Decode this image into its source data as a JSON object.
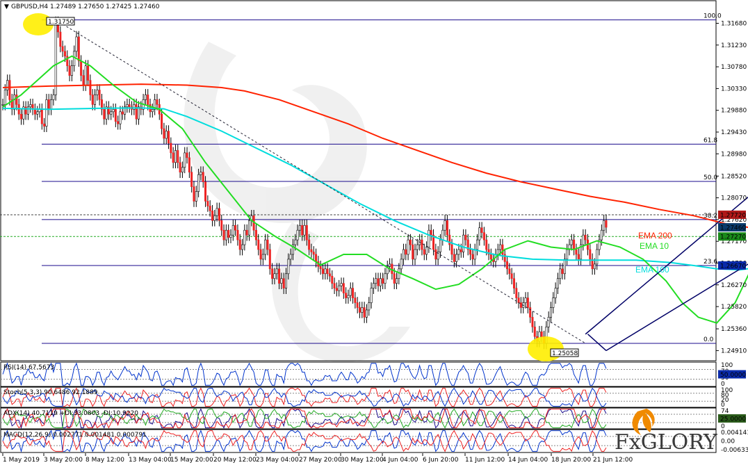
{
  "header": {
    "symbol": "GBPUSD,H4",
    "ohlc": "1.27489 1.27650 1.27425 1.27460"
  },
  "watermark": {
    "brand": "FxGLORY",
    "logo_name": "fxglory-logo"
  },
  "colors": {
    "ema200": "#ff2200",
    "ema10": "#22dd22",
    "ema100": "#00dddd",
    "fib": "#1a0a8c",
    "candle": "#ee2222",
    "channel": "#000066",
    "highlight": "#ffee00"
  },
  "chart_data": {
    "type": "candlestick",
    "title": "GBPUSD,H4",
    "ylim": [
      1.2487,
      1.3205
    ],
    "y_ticks": [
      "1.31680",
      "1.31230",
      "1.30780",
      "1.30330",
      "1.29880",
      "1.29430",
      "1.28980",
      "1.28520",
      "1.28070",
      "1.27620",
      "1.27170",
      "1.26720",
      "1.26270",
      "1.25820",
      "1.25360",
      "1.24910"
    ],
    "x_ticks": [
      "1 May 2019",
      "3 May 20:00",
      "8 May 12:00",
      "13 May 04:00",
      "15 May 20:00",
      "20 May 12:00",
      "23 May 04:00",
      "27 May 20:00",
      "30 May 12:00",
      "4 Jun 04:00",
      "6 Jun 20:00",
      "11 Jun 12:00",
      "14 Jun 04:00",
      "18 Jun 20:00",
      "21 Jun 12:00"
    ],
    "high": {
      "label": "1.31750",
      "value": 1.3175
    },
    "low": {
      "label": "1.25058",
      "value": 1.25058
    },
    "price_labels": [
      {
        "label": "1.27720",
        "value": 1.2772,
        "color": "#b01818"
      },
      {
        "label": "1.27460",
        "value": 1.2746,
        "color": "#0a3a6a"
      },
      {
        "label": "1.27270",
        "value": 1.2727,
        "color": "#1a8a1a"
      },
      {
        "label": "1.26670",
        "value": 1.2667,
        "color": "#0a2aaa"
      }
    ],
    "fibonacci": [
      {
        "label": "100.0",
        "value": 1.3175
      },
      {
        "label": "61.8",
        "value": 1.2918
      },
      {
        "label": "50.0",
        "value": 1.2841
      },
      {
        "label": "38.2",
        "value": 1.2762
      },
      {
        "label": "23.6",
        "value": 1.2667
      },
      {
        "label": "0.0",
        "value": 1.2506
      }
    ],
    "legend": [
      {
        "name": "EMA 200",
        "color": "#ff2200"
      },
      {
        "name": "EMA 10",
        "color": "#22dd22"
      },
      {
        "name": "EMA 100",
        "color": "#00dddd"
      }
    ],
    "ema200": [
      [
        0,
        1.3035
      ],
      [
        20,
        1.3038
      ],
      [
        40,
        1.304
      ],
      [
        60,
        1.3042
      ],
      [
        80,
        1.304
      ],
      [
        95,
        1.3035
      ],
      [
        105,
        1.3028
      ],
      [
        120,
        1.301
      ],
      [
        135,
        1.2985
      ],
      [
        150,
        1.296
      ],
      [
        165,
        1.293
      ],
      [
        180,
        1.2905
      ],
      [
        195,
        1.288
      ],
      [
        210,
        1.2858
      ],
      [
        225,
        1.284
      ],
      [
        240,
        1.2825
      ],
      [
        255,
        1.281
      ],
      [
        270,
        1.2798
      ],
      [
        285,
        1.2783
      ],
      [
        300,
        1.277
      ],
      [
        315,
        1.2752
      ],
      [
        325,
        1.2745
      ],
      [
        330,
        1.2743
      ],
      [
        334,
        1.2745
      ]
    ],
    "ema100": [
      [
        0,
        1.2992
      ],
      [
        20,
        1.299
      ],
      [
        40,
        1.2992
      ],
      [
        60,
        1.2993
      ],
      [
        70,
        1.2991
      ],
      [
        80,
        1.2975
      ],
      [
        95,
        1.2945
      ],
      [
        110,
        1.291
      ],
      [
        125,
        1.2875
      ],
      [
        140,
        1.2835
      ],
      [
        155,
        1.2795
      ],
      [
        170,
        1.276
      ],
      [
        185,
        1.273
      ],
      [
        200,
        1.2705
      ],
      [
        215,
        1.2688
      ],
      [
        230,
        1.268
      ],
      [
        245,
        1.2678
      ],
      [
        260,
        1.2678
      ],
      [
        275,
        1.2678
      ],
      [
        290,
        1.2673
      ],
      [
        300,
        1.2667
      ],
      [
        310,
        1.266
      ],
      [
        320,
        1.2658
      ],
      [
        334,
        1.2667
      ]
    ],
    "ema10": [
      [
        0,
        1.2995
      ],
      [
        8,
        1.302
      ],
      [
        15,
        1.305
      ],
      [
        22,
        1.308
      ],
      [
        30,
        1.31
      ],
      [
        38,
        1.308
      ],
      [
        48,
        1.304
      ],
      [
        58,
        1.3005
      ],
      [
        68,
        1.299
      ],
      [
        78,
        1.295
      ],
      [
        88,
        1.288
      ],
      [
        98,
        1.282
      ],
      [
        108,
        1.276
      ],
      [
        118,
        1.2728
      ],
      [
        128,
        1.27
      ],
      [
        138,
        1.2668
      ],
      [
        148,
        1.269
      ],
      [
        158,
        1.269
      ],
      [
        168,
        1.266
      ],
      [
        178,
        1.264
      ],
      [
        188,
        1.2618
      ],
      [
        198,
        1.2628
      ],
      [
        208,
        1.266
      ],
      [
        218,
        1.27
      ],
      [
        228,
        1.2718
      ],
      [
        238,
        1.2705
      ],
      [
        248,
        1.27
      ],
      [
        258,
        1.2718
      ],
      [
        268,
        1.2705
      ],
      [
        278,
        1.268
      ],
      [
        288,
        1.2635
      ],
      [
        295,
        1.259
      ],
      [
        302,
        1.256
      ],
      [
        310,
        1.2548
      ],
      [
        318,
        1.259
      ],
      [
        325,
        1.266
      ],
      [
        330,
        1.2695
      ],
      [
        334,
        1.2712
      ]
    ],
    "closes": [
      1.3,
      1.303,
      1.305,
      1.301,
      1.299,
      1.302,
      1.3,
      1.298,
      1.297,
      1.2995,
      1.298,
      1.2995,
      1.3,
      1.299,
      1.298,
      1.2985,
      1.299,
      1.296,
      1.2955,
      1.301,
      1.299,
      1.301,
      1.302,
      1.317,
      1.315,
      1.312,
      1.311,
      1.31,
      1.308,
      1.306,
      1.308,
      1.311,
      1.314,
      1.309,
      1.306,
      1.304,
      1.308,
      1.305,
      1.302,
      1.3,
      1.302,
      1.303,
      1.301,
      1.299,
      1.297,
      1.2995,
      1.298,
      1.2985,
      1.299,
      1.2965,
      1.296,
      1.2985,
      1.298,
      1.2995,
      1.3,
      1.2995,
      1.299,
      1.3,
      1.297,
      1.2995,
      1.299,
      1.301,
      1.302,
      1.3,
      1.2985,
      1.299,
      1.301,
      1.3,
      1.298,
      1.295,
      1.293,
      1.2945,
      1.292,
      1.29,
      1.288,
      1.2905,
      1.288,
      1.286,
      1.287,
      1.29,
      1.289,
      1.286,
      1.283,
      1.28,
      1.282,
      1.2855,
      1.286,
      1.284,
      1.28,
      1.279,
      1.278,
      1.276,
      1.277,
      1.2785,
      1.276,
      1.274,
      1.272,
      1.274,
      1.2725,
      1.273,
      1.275,
      1.274,
      1.272,
      1.27,
      1.271,
      1.274,
      1.273,
      1.276,
      1.277,
      1.274,
      1.272,
      1.27,
      1.268,
      1.269,
      1.272,
      1.27,
      1.266,
      1.264,
      1.265,
      1.266,
      1.263,
      1.264,
      1.262,
      1.265,
      1.268,
      1.269,
      1.271,
      1.272,
      1.274,
      1.275,
      1.273,
      1.275,
      1.272,
      1.27,
      1.2695,
      1.269,
      1.2675,
      1.2665,
      1.266,
      1.265,
      1.266,
      1.265,
      1.2645,
      1.263,
      1.262,
      1.2615,
      1.2625,
      1.263,
      1.261,
      1.26,
      1.2605,
      1.262,
      1.26,
      1.259,
      1.258,
      1.257,
      1.258,
      1.256,
      1.2575,
      1.259,
      1.262,
      1.263,
      1.264,
      1.2625,
      1.264,
      1.263,
      1.265,
      1.2665,
      1.267,
      1.265,
      1.263,
      1.264,
      1.266,
      1.268,
      1.27,
      1.269,
      1.272,
      1.271,
      1.268,
      1.27,
      1.271,
      1.272,
      1.27,
      1.269,
      1.2705,
      1.274,
      1.273,
      1.27,
      1.268,
      1.2695,
      1.272,
      1.274,
      1.276,
      1.273,
      1.271,
      1.269,
      1.2675,
      1.269,
      1.27,
      1.2695,
      1.273,
      1.272,
      1.27,
      1.269,
      1.268,
      1.27,
      1.272,
      1.2745,
      1.2735,
      1.272,
      1.27,
      1.269,
      1.268,
      1.2675,
      1.269,
      1.27,
      1.271,
      1.269,
      1.2675,
      1.266,
      1.265,
      1.264,
      1.262,
      1.26,
      1.259,
      1.258,
      1.259,
      1.26,
      1.258,
      1.256,
      1.254,
      1.252,
      1.251,
      1.253,
      1.252,
      1.2506,
      1.254,
      1.256,
      1.258,
      1.26,
      1.262,
      1.264,
      1.266,
      1.265,
      1.268,
      1.27,
      1.271,
      1.272,
      1.27,
      1.269,
      1.268,
      1.271,
      1.273,
      1.272,
      1.27,
      1.268,
      1.266,
      1.267,
      1.27,
      1.272,
      1.274,
      1.276,
      1.2746
    ],
    "subwindows": [
      {
        "name": "RSI",
        "label": "RSI(14) 67.5673",
        "scale": [
          "100",
          "70",
          "30",
          "0"
        ],
        "badge": "50.0000"
      },
      {
        "name": "Stochastic",
        "label": "Stoch(5,3,3) 90.6486 92.1889",
        "scale": [
          "100",
          "80",
          "20",
          "0"
        ],
        "badge": ""
      },
      {
        "name": "ADX",
        "label": "ADX(14) 40.7119 +DI:33.0803 -DI:10.9220",
        "scale": [
          "74",
          "0"
        ],
        "badge": "25.0000"
      },
      {
        "name": "MACD",
        "label": "MACD(12,26,9) 0.002771 0.001481 0.000791",
        "scale": [
          "0.004141",
          "0.00",
          "-0.006336"
        ],
        "badge": ""
      }
    ]
  }
}
